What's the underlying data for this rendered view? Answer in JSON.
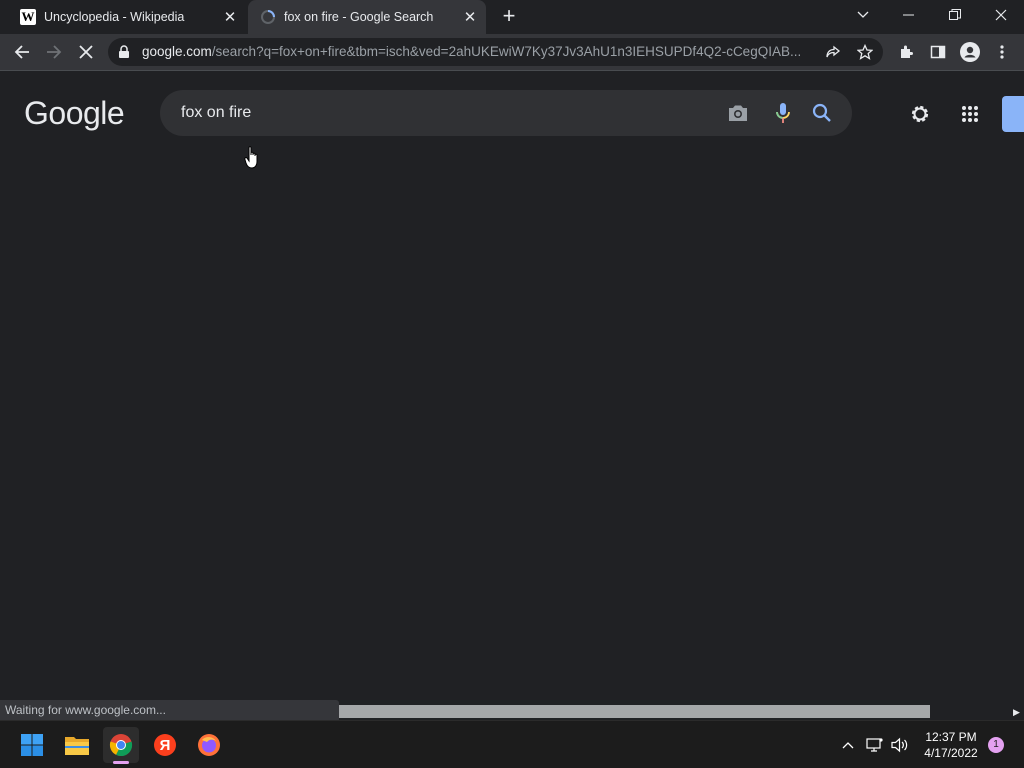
{
  "browser": {
    "tabs": [
      {
        "title": "Uncyclopedia - Wikipedia",
        "favicon": "W",
        "active": false
      },
      {
        "title": "fox on fire - Google Search",
        "favicon": "loading-spinner",
        "active": true
      }
    ],
    "address": {
      "host": "google.com",
      "path": "/search?q=fox+on+fire&tbm=isch&ved=2ahUKEwiW7Ky37Jv3AhU1n3IEHSUPDf4Q2-cCegQIAB..."
    },
    "status_text": "Waiting for www.google.com..."
  },
  "google": {
    "logo_text": "Google",
    "query": "fox on fire",
    "logo_colors": {
      "blue": "#8ab4f8",
      "red": "#f28b82",
      "yellow": "#fdd663",
      "green": "#81c995"
    }
  },
  "taskbar": {
    "time": "12:37 PM",
    "date": "4/17/2022",
    "notification_count": "1",
    "apps": [
      "start-icon",
      "file-explorer-icon",
      "chrome-icon",
      "yandex-icon",
      "firefox-icon"
    ],
    "yandex_letter": "Я"
  }
}
